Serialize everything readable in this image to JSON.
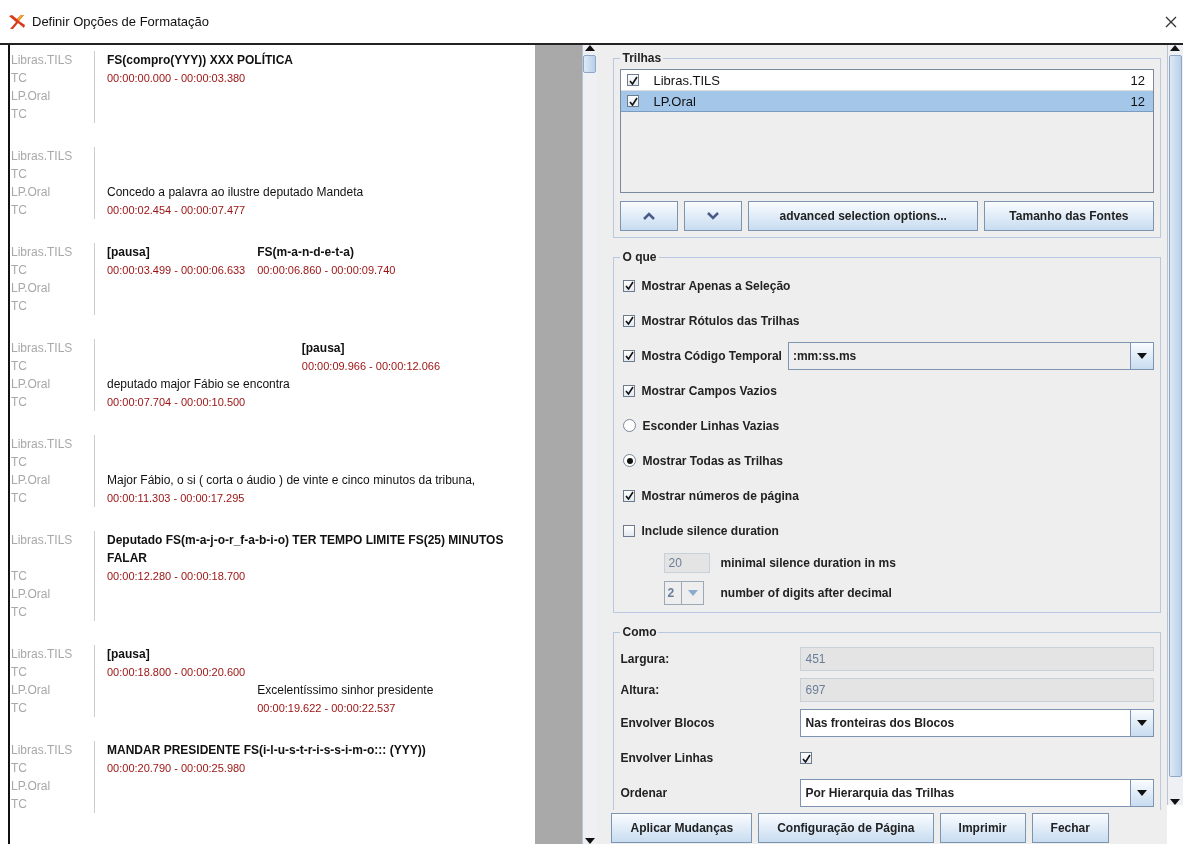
{
  "window": {
    "title": "Definir Opções de Formatação"
  },
  "preview": {
    "blocks": [
      {
        "tiers": [
          {
            "name": "Libras.TILS",
            "tc": "TC"
          },
          {
            "name": "LP.Oral",
            "tc": "TC"
          }
        ],
        "annotations": [
          {
            "kind": "gloss",
            "text": "FS(compro(YYY)) XXX POLÍTICA",
            "time": "00:00:00.000 - 00:00:03.380"
          }
        ]
      },
      {
        "tiers": [
          {
            "name": "Libras.TILS",
            "tc": "TC"
          },
          {
            "name": "LP.Oral",
            "tc": "TC"
          }
        ],
        "annotations": [
          {
            "kind": "translation",
            "text": "Concedo a palavra ao ilustre deputado Mandeta",
            "time": "00:00:02.454 - 00:00:07.477"
          }
        ]
      },
      {
        "tiers": [
          {
            "name": "Libras.TILS",
            "tc": "TC"
          },
          {
            "name": "LP.Oral",
            "tc": "TC"
          }
        ],
        "annotations": [
          {
            "kind": "gloss",
            "text": "[pausa]",
            "time": "00:00:03.499 - 00:00:06.633"
          },
          {
            "kind": "gloss",
            "text": "FS(m-a-n-d-e-t-a)",
            "time": "00:00:06.860 - 00:00:09.740"
          }
        ]
      },
      {
        "tiers": [
          {
            "name": "Libras.TILS",
            "tc": "TC"
          },
          {
            "name": "LP.Oral",
            "tc": "TC"
          }
        ],
        "annotations": [
          {
            "kind": "translation",
            "text": "deputado major Fábio se encontra",
            "time": "00:00:07.704 - 00:00:10.500"
          },
          {
            "kind": "gloss",
            "text": "[pausa]",
            "time": "00:00:09.966 - 00:00:12.066"
          }
        ]
      },
      {
        "tiers": [
          {
            "name": "Libras.TILS",
            "tc": "TC"
          },
          {
            "name": "LP.Oral",
            "tc": "TC"
          }
        ],
        "annotations": [
          {
            "kind": "translation",
            "text": "Major Fábio, o si ( corta o áudio ) de vinte e cinco minutos da tribuna,",
            "time": "00:00:11.303 - 00:00:17.295"
          }
        ]
      },
      {
        "tiers": [
          {
            "name": "Libras.TILS",
            "tc": "TC"
          },
          {
            "name": "LP.Oral",
            "tc": "TC"
          }
        ],
        "annotations": [
          {
            "kind": "gloss",
            "text": "Deputado FS(m-a-j-o-r_f-a-b-i-o) TER TEMPO LIMITE FS(25) MINUTOS FALAR",
            "time": "00:00:12.280 - 00:00:18.700"
          }
        ]
      },
      {
        "tiers": [
          {
            "name": "Libras.TILS",
            "tc": "TC"
          },
          {
            "name": "LP.Oral",
            "tc": "TC"
          }
        ],
        "annotations": [
          {
            "kind": "gloss",
            "text": "[pausa]",
            "time": "00:00:18.800 - 00:00:20.600"
          },
          {
            "kind": "translation",
            "text": "Excelentíssimo sinhor presidente",
            "time": "00:00:19.622 - 00:00:22.537"
          }
        ]
      },
      {
        "tiers": [
          {
            "name": "Libras.TILS",
            "tc": "TC"
          },
          {
            "name": "LP.Oral",
            "tc": "TC"
          }
        ],
        "annotations": [
          {
            "kind": "gloss",
            "text": "MANDAR PRESIDENTE FS(i-l-u-s-t-r-i-s-s-i-m-o::: (YYY))",
            "time": "00:00:20.790 - 00:00:25.980"
          }
        ]
      }
    ]
  },
  "tracks": {
    "title": "Trilhas",
    "items": [
      {
        "name": "Libras.TILS",
        "size": "12",
        "checked": true,
        "selected": false
      },
      {
        "name": "LP.Oral",
        "size": "12",
        "checked": true,
        "selected": true
      }
    ],
    "buttons": [
      "advanced selection options...",
      "Tamanho das Fontes"
    ]
  },
  "what": {
    "title": "O que",
    "options": [
      {
        "kind": "checkbox",
        "label": "Mostrar Apenas a Seleção",
        "checked": true
      },
      {
        "kind": "checkbox",
        "label": "Mostrar Rótulos das Trilhas",
        "checked": true
      },
      {
        "kind": "checkbox_combo",
        "label": "Mostra Código Temporal",
        "checked": true,
        "value": ":mm:ss.ms"
      },
      {
        "kind": "checkbox",
        "label": "Mostrar Campos Vazios",
        "checked": true
      },
      {
        "kind": "radio",
        "label": "Esconder Linhas Vazias",
        "selected": false
      },
      {
        "kind": "radio",
        "label": "Mostrar Todas as Trilhas",
        "selected": true
      },
      {
        "kind": "checkbox",
        "label": "Mostrar números de página",
        "checked": true
      },
      {
        "kind": "checkbox",
        "label": "Include silence duration",
        "checked": false,
        "children": [
          {
            "kind": "field",
            "label": "minimal silence duration in ms",
            "value": "20",
            "disabled": true
          },
          {
            "kind": "spinner",
            "label": "number of digits after decimal",
            "value": "2",
            "disabled": true
          }
        ]
      }
    ]
  },
  "how": {
    "title": "Como",
    "rows": [
      {
        "kind": "field",
        "label": "Largura:",
        "value": "451",
        "disabled": true
      },
      {
        "kind": "field",
        "label": "Altura:",
        "value": "697",
        "disabled": true
      },
      {
        "kind": "combo",
        "label": "Envolver Blocos",
        "value": "Nas fronteiras dos Blocos"
      },
      {
        "kind": "checkbox",
        "label": "Envolver Linhas",
        "checked": true
      },
      {
        "kind": "combo",
        "label": "Ordenar",
        "value": "Por Hierarquia das Trilhas"
      }
    ]
  },
  "buttons": [
    "Aplicar Mudanças",
    "Configuração de Página",
    "Imprimir",
    "Fechar"
  ]
}
